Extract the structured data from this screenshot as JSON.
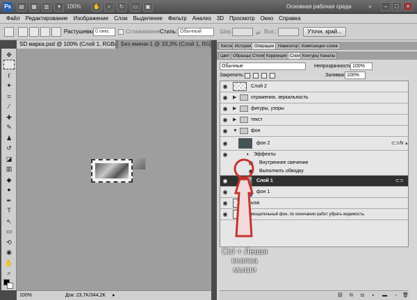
{
  "titlebar": {
    "logo": "Ps",
    "zoom": "100%",
    "workspace": "Основная рабочая среда"
  },
  "menu": [
    "Файл",
    "Редактирование",
    "Изображение",
    "Слои",
    "Выделение",
    "Фильтр",
    "Анализ",
    "3D",
    "Просмотр",
    "Окно",
    "Справка"
  ],
  "options": {
    "feather_label": "Растушевка:",
    "feather_value": "0 пикс",
    "antialias_label": "Сглаживание",
    "style_label": "Стиль:",
    "style_value": "Обычный",
    "width_label": "Шир.:",
    "height_label": "Выс.:",
    "refine_button": "Уточн. край..."
  },
  "doc_tabs": [
    {
      "label": "SD марка.psd @ 100% (Слой 1, RGB/8) *"
    },
    {
      "label": "Без имени-1 @ 33,3% (Слой 1, RGB/8)"
    }
  ],
  "status": {
    "zoom": "100%",
    "doc": "Док: 23,7K/344,2K"
  },
  "panel": {
    "tabs_row1": [
      "Кисти",
      "История",
      "Операции",
      "Навигатор",
      "Композиции слоев"
    ],
    "tabs_row2": [
      "Цвет",
      "Образцы",
      "Стили",
      "Коррекция",
      "Слои",
      "Контуры",
      "Каналы"
    ],
    "blend_mode": "Обычные",
    "opacity_label": "Непрозрачность:",
    "opacity_value": "100%",
    "lock_label": "Закрепить:",
    "fill_label": "Заливка:",
    "fill_value": "100%"
  },
  "layers": [
    {
      "name": "Слой 2"
    },
    {
      "name": "отражения, зеркальность"
    },
    {
      "name": "фигуры, узоры"
    },
    {
      "name": "текст"
    },
    {
      "name": "фон"
    },
    {
      "name": "фон 2",
      "fx": "fx"
    },
    {
      "name": "Эффекты"
    },
    {
      "name": "Внутреннее свечение"
    },
    {
      "name": "Выполнить обводку"
    },
    {
      "name": "Слой 1"
    },
    {
      "name": "фон 1"
    },
    {
      "name": "ыза"
    },
    {
      "name": "мощательный фон, по окончании работ убрать видимость."
    }
  ],
  "annotation": {
    "line1": "Ctrl + Левая",
    "line2": "кнопка",
    "line3": "мыши"
  },
  "colors": {
    "annotation_red": "#c4342c",
    "selected_layer": "#303030"
  }
}
